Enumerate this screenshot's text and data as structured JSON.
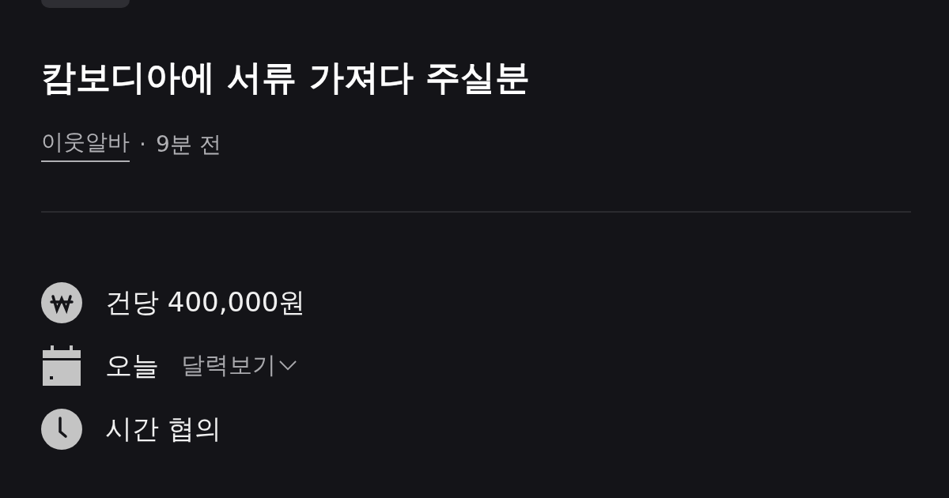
{
  "title": "캄보디아에 서류 가져다 주실분",
  "meta": {
    "author": "이웃알바",
    "separator": "·",
    "time": "9분 전"
  },
  "details": [
    {
      "kind": "pay",
      "text": "건당 400,000원"
    },
    {
      "kind": "date",
      "text": "오늘",
      "link": "달력보기"
    },
    {
      "kind": "time",
      "text": "시간 협의"
    }
  ]
}
